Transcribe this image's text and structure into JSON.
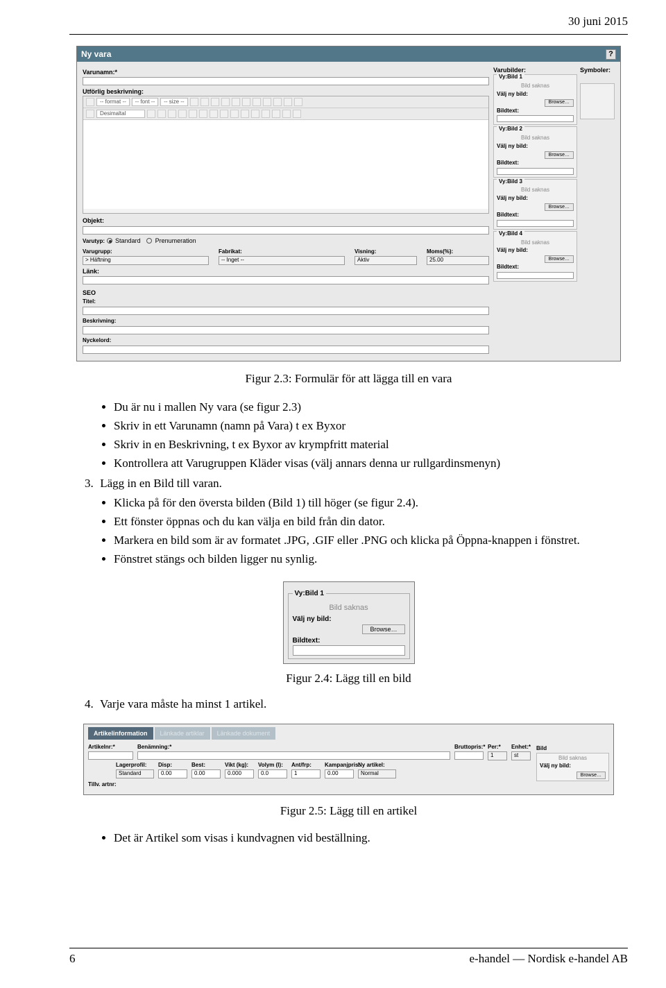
{
  "header": {
    "date": "30 juni 2015"
  },
  "dialog": {
    "title": "Ny vara",
    "help_icon": "?",
    "labels": {
      "varunamn": "Varunamn:*",
      "utforlig": "Utförlig beskrivning:",
      "objekt": "Objekt:",
      "varutyp": "Varutyp:",
      "standard": "Standard",
      "prenumeration": "Prenumeration",
      "varugrupp": "Varugrupp:",
      "fabrikat": "Fabrikat:",
      "visning": "Visning:",
      "moms": "Moms(%):",
      "lank": "Länk:",
      "seo": "SEO",
      "titel": "Titel:",
      "beskriv": "Beskrivning:",
      "nyckelord": "Nyckelord:"
    },
    "editor": {
      "format": "-- format --",
      "font": "-- font --",
      "size": "-- size --",
      "decimal": "Desimaltal"
    },
    "values": {
      "varugrupp": "> Häftning",
      "fabrikat": "-- Inget --",
      "visning": "Aktiv",
      "moms": "25.00"
    },
    "right": {
      "varubilder": "Varubilder:",
      "symboler": "Symboler:",
      "vy": [
        "Vy:Bild 1",
        "Vy:Bild 2",
        "Vy:Bild 3",
        "Vy:Bild 4"
      ],
      "bild_saknas": "Bild saknas",
      "valj_ny_bild": "Välj ny bild:",
      "bildtext": "Bildtext:",
      "browse": "Browse…"
    }
  },
  "captions": {
    "c1": "Figur 2.3: Formulär för att lägga till en vara",
    "c2": "Figur 2.4: Lägg till en bild",
    "c3": "Figur 2.5: Lägg till en artikel"
  },
  "body": {
    "b1": "Du är nu i mallen Ny vara (se figur 2.3)",
    "b2": "Skriv in ett Varunamn (namn på Vara) t ex Byxor",
    "b3": "Skriv in en Beskrivning, t ex Byxor av krympfritt material",
    "b4": "Kontrollera att Varugruppen Kläder visas (välj annars denna ur rullgardinsmenyn)",
    "s3_label": "3.",
    "s3_text": "Lägg in en Bild till varan.",
    "b5": "Klicka på för den översta bilden (Bild 1) till höger (se figur 2.4).",
    "b6": "Ett fönster öppnas och du kan välja en bild från din dator.",
    "b7": "Markera en bild som är av formatet .JPG, .GIF eller .PNG och klicka på Öppna-knappen i fönstret.",
    "b8": "Fönstret stängs och bilden ligger nu synlig.",
    "s4_label": "4.",
    "s4_text": "Varje vara måste ha minst 1 artikel.",
    "last": "Det är Artikel som visas i kundvagnen vid beställning."
  },
  "ss2": {
    "legend": "Vy:Bild 1",
    "miss": "Bild saknas",
    "valj": "Välj ny bild:",
    "browse": "Browse…",
    "bildtext": "Bildtext:"
  },
  "ss3": {
    "tabs": [
      "Artikelinformation",
      "Länkade artiklar",
      "Länkade dokument"
    ],
    "labels": {
      "artikelnr": "Artikelnr:*",
      "benamning": "Benämning:*",
      "bruttopris": "Bruttopris:*",
      "per": "Per:*",
      "enhet": "Enhet:*",
      "bild": "Bild",
      "lagerprofil": "Lagerprofil:",
      "disp": "Disp:",
      "best": "Best:",
      "vikt": "Vikt (kg):",
      "volym": "Volym (l):",
      "antfrp": "Ant/frp:",
      "kampanjpris": "Kampanjpris:",
      "ny_artikel": "Ny artikel:",
      "tillv": "Tillv. artnr:"
    },
    "values": {
      "lagerprofil": "Standard",
      "disp": "0.00",
      "best": "0.00",
      "vikt": "0.000",
      "volym": "0.0",
      "antfrp": "1",
      "per": "1",
      "enhet": "st",
      "kampanjpris": "0.00",
      "ny_artikel": "Normal"
    },
    "bild_saknas": "Bild saknas",
    "valj": "Välj ny bild:",
    "browse": "Browse…"
  },
  "footer": {
    "page": "6",
    "right": "e-handel — Nordisk e-handel AB"
  }
}
